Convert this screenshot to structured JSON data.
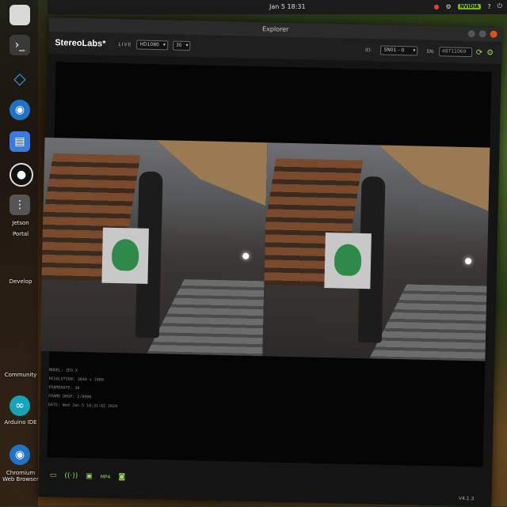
{
  "topbar": {
    "clock": "Jan 5  18:31",
    "tray_badge": "NVIDIA",
    "tray_help": "?"
  },
  "dock": {
    "labels": [
      "Jetson",
      "Portal",
      "Develop",
      "Community",
      "Arduino IDE",
      "Chromium Web Browser"
    ]
  },
  "window": {
    "title": "Explorer"
  },
  "appbar": {
    "brand": "StereoLabs*",
    "live": "LIVE",
    "resolution": "HD1080",
    "fps": "30",
    "id_label": "ID:",
    "id_value": "SN01 - 0",
    "sn_label": "SN:",
    "sn_value": "48711069"
  },
  "info": {
    "model": "MODEL: ZED X",
    "resolution": "RESOLUTION: 3840 x 1080",
    "framerate": "FRAMERATE: 30",
    "frame_drop": "FRAME DROP: 2/9990",
    "date": "DATE: Wed Jan 5 18:31:02 2024"
  },
  "footer": {
    "version": "V4.1.3"
  },
  "colors": {
    "accent": "#9cd35c",
    "nvidia": "#76b900",
    "close": "#e0501f"
  }
}
